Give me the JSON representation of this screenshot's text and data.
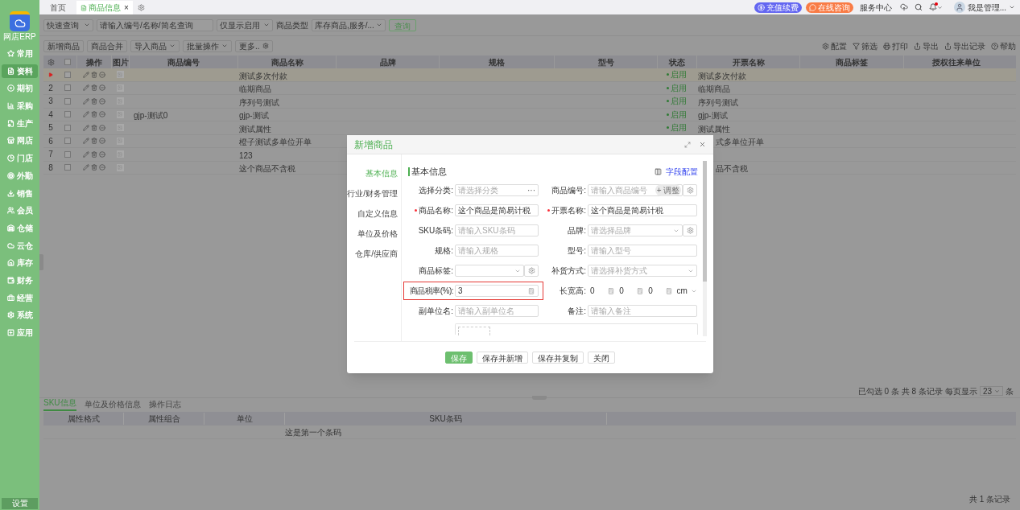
{
  "sidebar": {
    "app_name": "网店ERP",
    "items": [
      {
        "label": "常用",
        "selected": false
      },
      {
        "label": "资料",
        "selected": true
      },
      {
        "label": "期初",
        "selected": false
      },
      {
        "label": "采购",
        "selected": false
      },
      {
        "label": "生产",
        "selected": false
      },
      {
        "label": "网店",
        "selected": false
      },
      {
        "label": "门店",
        "selected": false
      },
      {
        "label": "外勤",
        "selected": false
      },
      {
        "label": "销售",
        "selected": false
      },
      {
        "label": "会员",
        "selected": false
      },
      {
        "label": "仓储",
        "selected": false
      },
      {
        "label": "云仓",
        "selected": false
      },
      {
        "label": "库存",
        "selected": false
      },
      {
        "label": "财务",
        "selected": false
      },
      {
        "label": "经营",
        "selected": false
      },
      {
        "label": "系统",
        "selected": false
      },
      {
        "label": "应用",
        "selected": false
      }
    ],
    "footer": "设置"
  },
  "tabs": [
    {
      "label": "首页",
      "selected": false
    },
    {
      "label": "商品信息",
      "selected": true,
      "close": "×"
    }
  ],
  "header_actions": {
    "recharge": "充值续费",
    "consult": "在线咨询",
    "service": "服务中心",
    "user": "我是管理..."
  },
  "filters": {
    "quick": "快速查询",
    "search_placeholder": "请输入编号/名称/简名查询",
    "enabled": "仅显示启用",
    "type_label": "商品类型",
    "type_value": "库存商品,服务/...",
    "query": "查询"
  },
  "toolbar": {
    "buttons": [
      {
        "label": "新增商品",
        "dropdown": false
      },
      {
        "label": "商品合并",
        "dropdown": false
      },
      {
        "label": "导入商品",
        "dropdown": true
      },
      {
        "label": "批量操作",
        "dropdown": true
      },
      {
        "label": "更多..",
        "dropdown": false
      }
    ],
    "actions": [
      "配置",
      "筛选",
      "打印",
      "导出",
      "导出记录",
      "帮助"
    ]
  },
  "table": {
    "all_checked": false,
    "columns": [
      "操作",
      "图片",
      "商品编号",
      "商品名称",
      "品牌",
      "规格",
      "型号",
      "状态",
      "开票名称",
      "商品标签",
      "授权往来单位"
    ],
    "rows": [
      {
        "selected": true,
        "checked": false,
        "code": "",
        "name": "测试多次付款",
        "status": "启用",
        "invoice": "测试多次付款"
      },
      {
        "selected": false,
        "checked": false,
        "no": "2",
        "code": "",
        "name": "临期商品",
        "status": "启用",
        "invoice": "临期商品"
      },
      {
        "selected": false,
        "checked": false,
        "no": "3",
        "code": "",
        "name": "序列号测试",
        "status": "启用",
        "invoice": "序列号测试"
      },
      {
        "selected": false,
        "checked": false,
        "no": "4",
        "code": "gjp-测试0",
        "name": "gjp-测试",
        "status": "启用",
        "invoice": "gjp-测试"
      },
      {
        "selected": false,
        "checked": false,
        "no": "5",
        "code": "",
        "name": "测试属性",
        "status": "启用",
        "invoice": "测试属性"
      },
      {
        "selected": false,
        "checked": false,
        "no": "6",
        "code": "",
        "name": "橙子测试多单位开单",
        "invoice": "式多单位开单"
      },
      {
        "selected": false,
        "checked": false,
        "no": "7",
        "code": "",
        "name": "123"
      },
      {
        "selected": false,
        "checked": false,
        "no": "8",
        "code": "",
        "name": "这个商品不含税",
        "invoice": "品不含税"
      }
    ]
  },
  "pagination": {
    "checked": "已勾选 0 条",
    "total": "共 8 条记录",
    "per_page_label": "每页显示",
    "per_page": "23",
    "unit": "条"
  },
  "detail_tabs": [
    {
      "label": "SKU信息",
      "selected": true
    },
    {
      "label": "单位及价格信息",
      "selected": false
    },
    {
      "label": "操作日志",
      "selected": false
    }
  ],
  "detail_table": {
    "columns": [
      "属性格式",
      "属性组合",
      "单位",
      "SKU条码"
    ],
    "rows": [
      [
        "",
        "",
        "",
        "这是第一个条码"
      ]
    ],
    "total": "共 1 条记录"
  },
  "dialog": {
    "title": "新增商品",
    "nav": [
      {
        "label": "基本信息",
        "selected": true
      },
      {
        "label": "行业/财务管理",
        "selected": false
      },
      {
        "label": "自定义信息",
        "selected": false
      },
      {
        "label": "单位及价格",
        "selected": false
      },
      {
        "label": "仓库/供应商",
        "selected": false
      }
    ],
    "section": "基本信息",
    "field_config": "字段配置",
    "fields": [
      {
        "kind": "more",
        "label": "选择分类:",
        "placeholder": "请选择分类",
        "suffix": "···"
      },
      {
        "kind": "code",
        "label": "商品编号:",
        "placeholder": "请输入商品编号",
        "pill": "+ 调整"
      },
      {
        "kind": "text",
        "label": "商品名称:",
        "required": true,
        "value": "这个商品是简易计税"
      },
      {
        "kind": "text",
        "label": "开票名称:",
        "required": true,
        "value": "这个商品是简易计税"
      },
      {
        "kind": "text",
        "label": "SKU条码:",
        "placeholder": "请输入SKU条码"
      },
      {
        "kind": "select_gear",
        "label": "品牌:",
        "placeholder": "请选择品牌"
      },
      {
        "kind": "text",
        "label": "规格:",
        "placeholder": "请输入规格"
      },
      {
        "kind": "text",
        "label": "型号:",
        "placeholder": "请输入型号"
      },
      {
        "kind": "select_gear",
        "label": "商品标签:"
      },
      {
        "kind": "select",
        "label": "补货方式:",
        "placeholder": "请选择补货方式"
      },
      {
        "kind": "number",
        "label": "商品税率(%):",
        "value": "3",
        "highlighted": true
      },
      {
        "kind": "dims",
        "label": "长宽高:",
        "values": [
          "0",
          "0",
          "0"
        ],
        "unit": "cm"
      },
      {
        "kind": "text",
        "label": "副单位名:",
        "placeholder": "请输入副单位名"
      },
      {
        "kind": "text",
        "label": "备注:",
        "placeholder": "请输入备注"
      }
    ],
    "buttons": [
      {
        "label": "保存",
        "primary": true
      },
      {
        "label": "保存并新增",
        "primary": false
      },
      {
        "label": "保存并复制",
        "primary": false
      },
      {
        "label": "关闭",
        "primary": false
      }
    ]
  }
}
